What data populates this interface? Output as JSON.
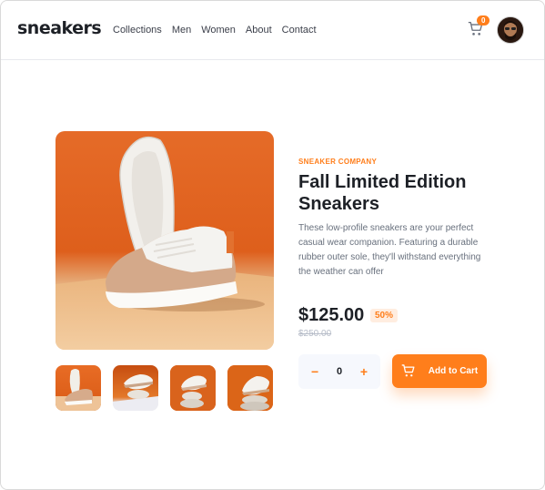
{
  "header": {
    "logo": "sneakers",
    "nav": [
      "Collections",
      "Men",
      "Women",
      "About",
      "Contact"
    ],
    "cart_count": "0",
    "cart_icon": "cart-icon",
    "avatar": "avatar"
  },
  "product": {
    "company": "SNEAKER COMPANY",
    "title": "Fall Limited Edition Sneakers",
    "description": "These low-profile sneakers are your perfect casual wear companion. Featuring a durable rubber outer sole, they'll withstand everything the weather can offer",
    "price": "$125.00",
    "discount": "50%",
    "original_price": "$250.00"
  },
  "quantity": {
    "minus": "−",
    "value": "0",
    "plus": "+"
  },
  "add_to_cart": {
    "label": "Add to Cart",
    "icon": "cart-icon"
  },
  "colors": {
    "accent": "#ff7e1b",
    "accent_pale": "#ffede0",
    "dark": "#1d2026",
    "muted": "#68707d"
  }
}
